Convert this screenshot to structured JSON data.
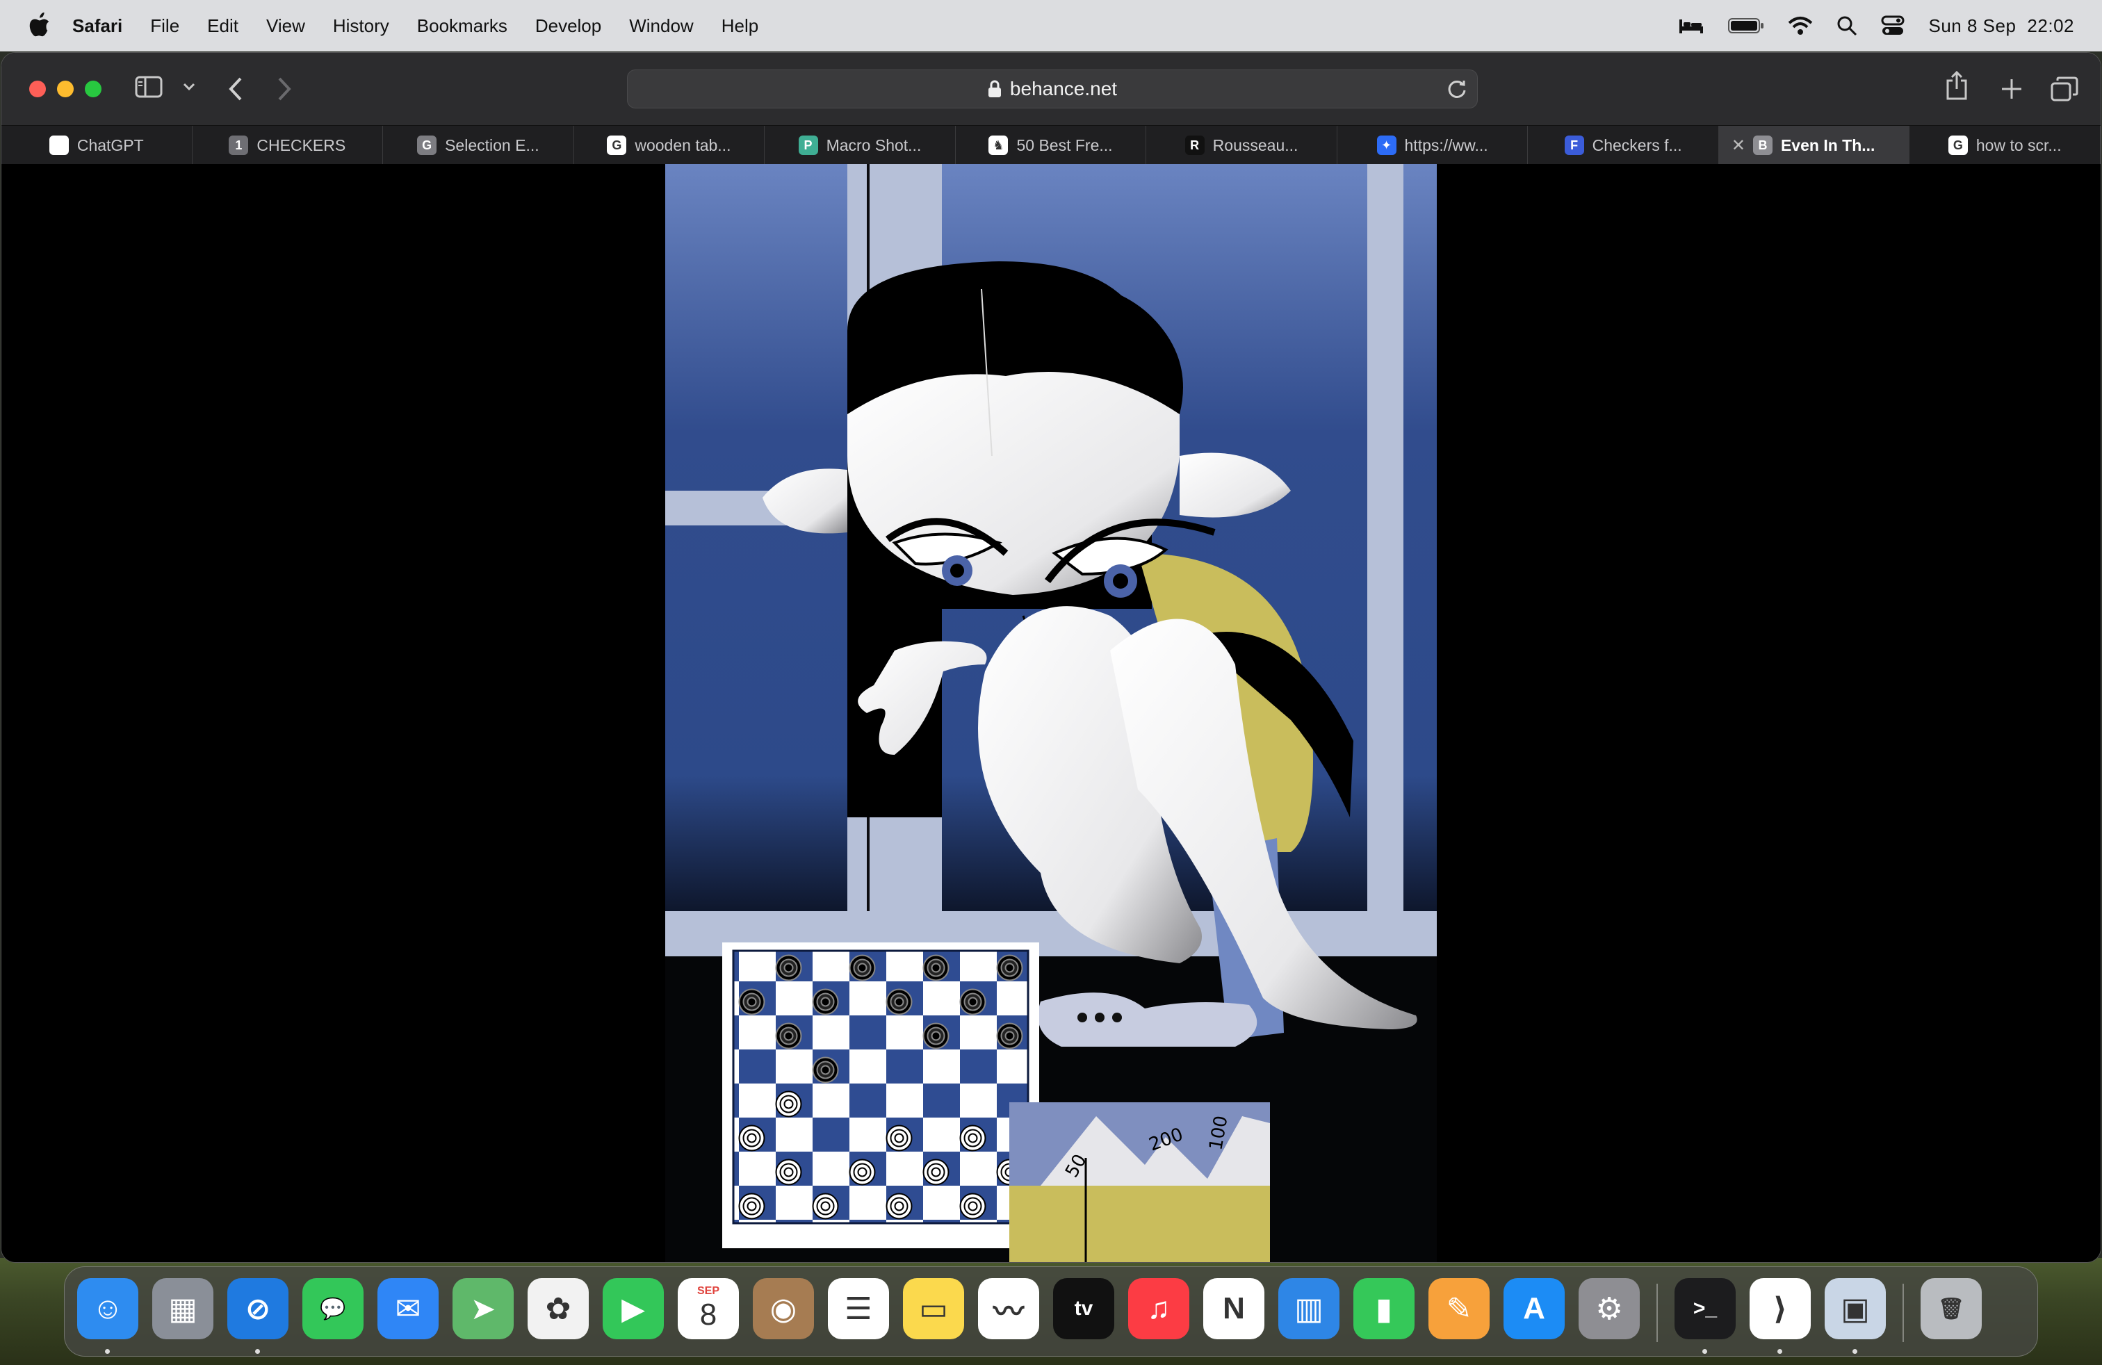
{
  "menubar": {
    "app_name": "Safari",
    "items": [
      "File",
      "Edit",
      "View",
      "History",
      "Bookmarks",
      "Develop",
      "Window",
      "Help"
    ],
    "date": "Sun 8 Sep",
    "time": "22:02",
    "status_icons": [
      "bed-icon",
      "battery-icon",
      "wifi-icon",
      "spotlight-search-icon",
      "control-center-icon"
    ]
  },
  "browser": {
    "url": "behance.net",
    "tabs": [
      {
        "label": "ChatGPT",
        "icon": "chatgpt-icon",
        "fav_text": "",
        "color": "#ffffff"
      },
      {
        "label": "CHECKERS",
        "icon": "number-one-icon",
        "fav_text": "1",
        "color": "#6e6e73"
      },
      {
        "label": "Selection E...",
        "icon": "letter-g-icon",
        "fav_text": "G",
        "color": "#7d7d82"
      },
      {
        "label": "wooden tab...",
        "icon": "google-icon",
        "fav_text": "G",
        "color": "#ffffff"
      },
      {
        "label": "Macro Shot...",
        "icon": "p-icon",
        "fav_text": "P",
        "color": "#3fae94"
      },
      {
        "label": "50 Best Fre...",
        "icon": "chess-icon",
        "fav_text": "♞",
        "color": "#ffffff"
      },
      {
        "label": "Rousseau...",
        "icon": "rousseau-icon",
        "fav_text": "R",
        "color": "#111111"
      },
      {
        "label": "https://ww...",
        "icon": "dropbox-icon",
        "fav_text": "✦",
        "color": "#2d6cf6"
      },
      {
        "label": "Checkers f...",
        "icon": "f-icon",
        "fav_text": "F",
        "color": "#3b5cd9"
      },
      {
        "label": "Even In Th...",
        "icon": "behance-icon",
        "fav_text": "B",
        "color": "#8e8e93",
        "active": true
      },
      {
        "label": "how to scr...",
        "icon": "google-icon",
        "fav_text": "G",
        "color": "#ffffff"
      }
    ]
  },
  "artwork": {
    "box_labels": [
      "100",
      "200",
      "50"
    ]
  },
  "dock": {
    "apps": [
      {
        "name": "finder-icon",
        "color": "#2e8cf0",
        "glyph": "☺",
        "running": true
      },
      {
        "name": "launchpad-icon",
        "color": "#8a8f98",
        "glyph": "▦",
        "running": false
      },
      {
        "name": "safari-icon",
        "color": "#1f7ae0",
        "glyph": "⊘",
        "running": true
      },
      {
        "name": "messages-icon",
        "color": "#33c759",
        "glyph": "💬",
        "running": false
      },
      {
        "name": "mail-icon",
        "color": "#2f86f6",
        "glyph": "✉",
        "running": false
      },
      {
        "name": "maps-icon",
        "color": "#5fb86a",
        "glyph": "➤",
        "running": false
      },
      {
        "name": "photos-icon",
        "color": "#f2f2f2",
        "glyph": "✿",
        "running": false
      },
      {
        "name": "facetime-icon",
        "color": "#33c759",
        "glyph": "▶",
        "running": false
      },
      {
        "name": "calendar-icon",
        "color": "#ffffff",
        "glyph": "8",
        "running": false
      },
      {
        "name": "contacts-icon",
        "color": "#a67c52",
        "glyph": "◉",
        "running": false
      },
      {
        "name": "reminders-icon",
        "color": "#ffffff",
        "glyph": "☰",
        "running": false
      },
      {
        "name": "notes-icon",
        "color": "#fbd94d",
        "glyph": "▭",
        "running": false
      },
      {
        "name": "freeform-icon",
        "color": "#ffffff",
        "glyph": "〰",
        "running": false
      },
      {
        "name": "apple-tv-icon",
        "color": "#111111",
        "glyph": "tv",
        "running": false
      },
      {
        "name": "music-icon",
        "color": "#fc3c44",
        "glyph": "♫",
        "running": false
      },
      {
        "name": "news-icon",
        "color": "#ffffff",
        "glyph": "N",
        "running": false
      },
      {
        "name": "keynote-icon",
        "color": "#2e86e6",
        "glyph": "▥",
        "running": false
      },
      {
        "name": "numbers-icon",
        "color": "#35c859",
        "glyph": "▮",
        "running": false
      },
      {
        "name": "pages-icon",
        "color": "#f7a13b",
        "glyph": "✎",
        "running": false
      },
      {
        "name": "app-store-icon",
        "color": "#1c8cf5",
        "glyph": "A",
        "running": false
      },
      {
        "name": "system-settings-icon",
        "color": "#8e8e93",
        "glyph": "⚙",
        "running": false
      },
      {
        "name": "terminal-icon",
        "color": "#1c1c1e",
        "glyph": ">_",
        "running": true
      },
      {
        "name": "vscode-icon",
        "color": "#ffffff",
        "glyph": "⟩",
        "running": true
      },
      {
        "name": "preview-icon",
        "color": "#c9d6e6",
        "glyph": "▣",
        "running": true
      },
      {
        "name": "trash-icon",
        "color": "#b9bcc0",
        "glyph": "🗑",
        "running": false
      }
    ],
    "calendar_month": "SEP",
    "calendar_day": "8"
  }
}
